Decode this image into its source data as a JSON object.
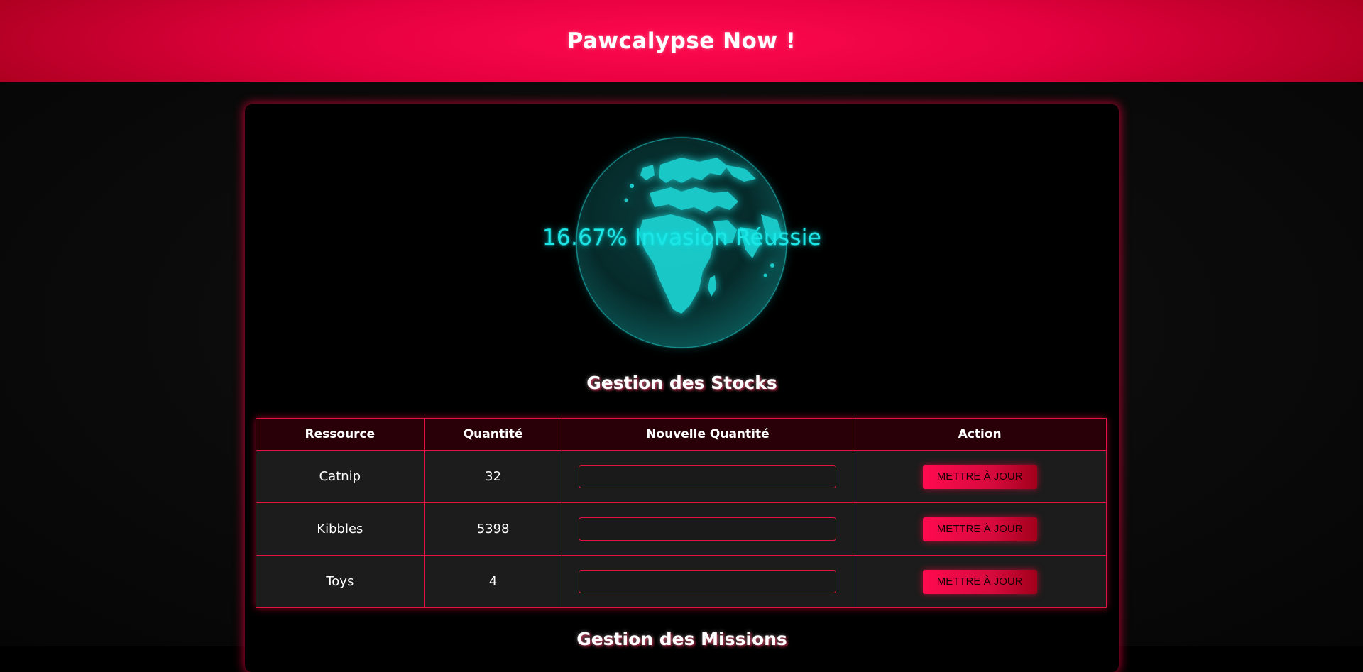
{
  "app": {
    "title": "Pawcalypse Now !"
  },
  "invasion": {
    "text": "16.67% Invasion Réussie",
    "percent": 16.67
  },
  "stocks": {
    "title": "Gestion des Stocks",
    "columns": [
      "Ressource",
      "Quantité",
      "Nouvelle Quantité",
      "Action"
    ],
    "rows": [
      {
        "resource": "Catnip",
        "quantity": "32",
        "new_quantity": "",
        "action_label": "METTRE À JOUR"
      },
      {
        "resource": "Kibbles",
        "quantity": "5398",
        "new_quantity": "",
        "action_label": "METTRE À JOUR"
      },
      {
        "resource": "Toys",
        "quantity": "4",
        "new_quantity": "",
        "action_label": "METTRE À JOUR"
      }
    ]
  },
  "missions": {
    "title": "Gestion des Missions"
  },
  "colors": {
    "accent": "#ff0a4e",
    "glow": "#1fe6e6",
    "border": "#e0153f"
  },
  "icons": {
    "globe": "earth-globe-icon"
  }
}
